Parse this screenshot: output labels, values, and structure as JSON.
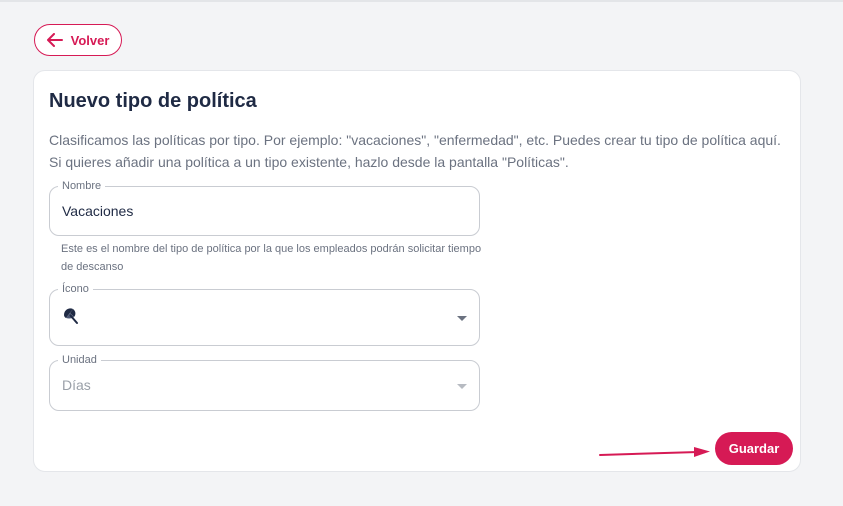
{
  "header": {
    "back_label": "Volver"
  },
  "card": {
    "title": "Nuevo tipo de política",
    "description": "Clasificamos las políticas por tipo. Por ejemplo: \"vacaciones\", \"enfermedad\", etc. Puedes crear tu tipo de política aquí. Si quieres añadir una política a un tipo existente, hazlo desde la pantalla \"Políticas\"."
  },
  "form": {
    "name": {
      "label": "Nombre",
      "value": "Vacaciones",
      "helper": "Este es el nombre del tipo de política por la que los empleados podrán solicitar tiempo de descanso"
    },
    "icon": {
      "label": "Ícono",
      "selected_icon": "beach-umbrella-icon"
    },
    "unit": {
      "label": "Unidad",
      "value": "Días"
    }
  },
  "actions": {
    "save_label": "Guardar"
  },
  "colors": {
    "accent": "#d61a55",
    "text_dark": "#1f2a44",
    "text_muted": "#6b7280"
  }
}
